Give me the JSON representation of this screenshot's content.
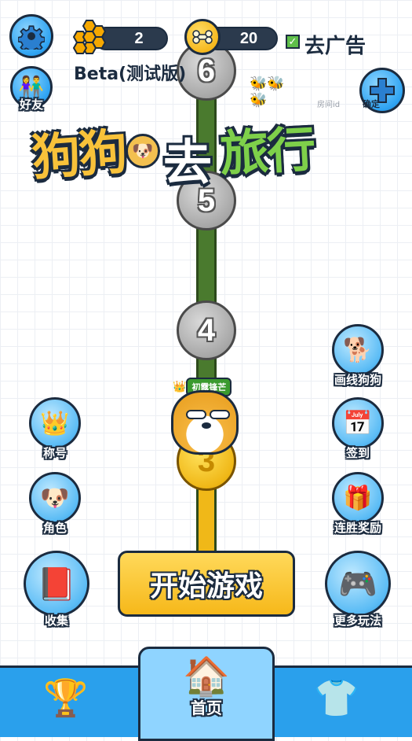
{
  "top_bar": {
    "honey_count": "2",
    "bone_count": "20",
    "remove_ads_label": "去广告",
    "remove_ads_checked": true,
    "version_label": "Beta(测试版)",
    "friends_label": "好友",
    "room_id_placeholder": "房间id",
    "confirm_label": "确定"
  },
  "title": {
    "word1": "狗狗",
    "word2": "去",
    "word3": "旅行"
  },
  "path": {
    "levels": [
      "6",
      "5",
      "4",
      "3"
    ],
    "player_badge": "初露锋芒"
  },
  "left_menu": [
    {
      "label": "称号",
      "icon": "crown-badge-icon"
    },
    {
      "label": "角色",
      "icon": "shiba-face-icon"
    },
    {
      "label": "收集",
      "icon": "paw-book-icon"
    }
  ],
  "right_menu": [
    {
      "label": "画线狗狗",
      "icon": "draw-dog-icon"
    },
    {
      "label": "签到",
      "icon": "calendar-icon"
    },
    {
      "label": "连胜奖励",
      "icon": "treasure-chest-icon"
    },
    {
      "label": "更多玩法",
      "icon": "gamepad-icon"
    }
  ],
  "start_button": "开始游戏",
  "bottom_nav": {
    "left_icon": "trophy-icon",
    "home_label": "首页",
    "right_icon": "clothes-icon"
  },
  "colors": {
    "accent_blue": "#2aa0ec",
    "button_gold": "#f6b81a",
    "path_green": "#4a7a2e",
    "title_yellow": "#f8c23a",
    "title_white": "#ffffff",
    "title_green": "#7ed04a"
  }
}
